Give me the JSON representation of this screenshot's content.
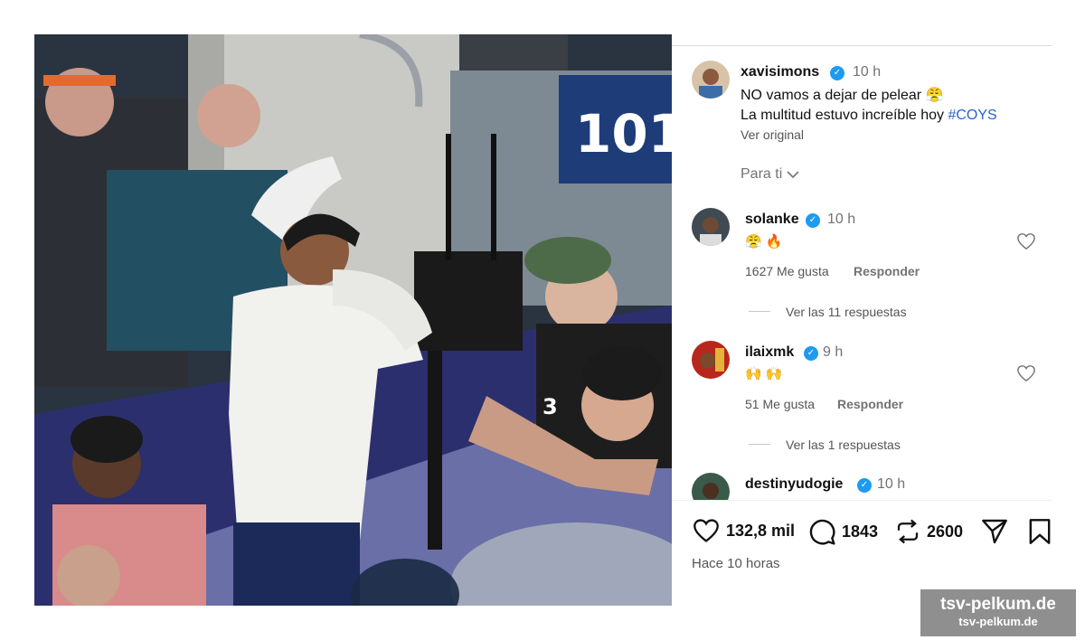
{
  "post": {
    "author": "xavisimons",
    "time": "10 h",
    "caption_line1": "NO vamos a dejar de pelear 😤",
    "caption_line2_text": "La multitud estuvo increíble hoy ",
    "caption_hashtag": "#COYS",
    "see_original": "Ver original",
    "sort_label": "Para ti"
  },
  "photo": {
    "stand_number": "101",
    "bib_number": "3"
  },
  "comments": [
    {
      "user": "solanke",
      "time": "10 h",
      "text": "😤 🔥",
      "likes": "1627 Me gusta",
      "reply_label": "Responder",
      "view_replies": "Ver las 11 respuestas"
    },
    {
      "user": "ilaixmk",
      "time": "9 h",
      "text": "🙌 🙌",
      "likes": "51 Me gusta",
      "reply_label": "Responder",
      "view_replies": "Ver las 1 respuestas"
    },
    {
      "user": "destinyudogie",
      "time": "10 h"
    }
  ],
  "actions": {
    "likes": "132,8 mil",
    "comments": "1843",
    "reposts": "2600",
    "posted": "Hace 10 horas"
  },
  "watermark": {
    "big": "tsv-pelkum.de",
    "small": "tsv-pelkum.de"
  },
  "colors": {
    "verified": "#1d9bf0",
    "hashtag": "#2a64c6",
    "muted": "#737373"
  }
}
